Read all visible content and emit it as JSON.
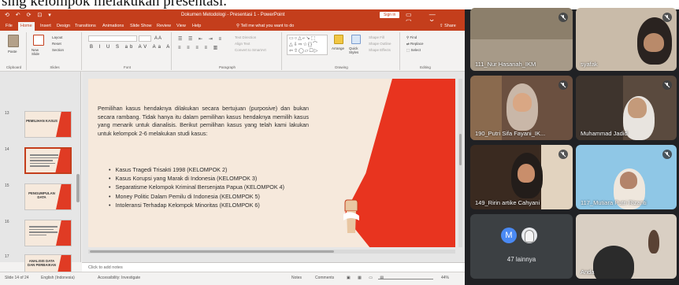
{
  "caption": {
    "text": "sing kelompok melakukan presentasi."
  },
  "powerpoint": {
    "quick_access": "⟲ ↶ ⟳ ⊡ ▾",
    "document_title": "Dokumen Metodologi - Presentasi 1 - PowerPoint",
    "sign_in": "Sign in",
    "window_controls": "▭ — ▢ ✕",
    "tabs": [
      "File",
      "Home",
      "Insert",
      "Design",
      "Transitions",
      "Animations",
      "Slide Show",
      "Review",
      "View",
      "Help"
    ],
    "tell_me": "Tell me what you want to do",
    "share": "Share",
    "ribbon_groups": [
      "Clipboard",
      "Slides",
      "Font",
      "Paragraph",
      "Drawing",
      "Editing"
    ],
    "ribbon_labels": {
      "paste": "Paste",
      "new_slide": "New Slide",
      "layout": "Layout",
      "reset": "Reset",
      "section": "Section",
      "arrange": "Arrange",
      "quick_styles": "Quick Styles",
      "shape_fill": "Shape Fill",
      "shape_outline": "Shape Outline",
      "shape_effects": "Shape Effects",
      "find": "Find",
      "replace": "Replace",
      "select": "Select",
      "text_direction": "Text Direction",
      "align_text": "Align Text",
      "convert_smartart": "Convert to SmartArt"
    },
    "thumbnails": [
      {
        "number": "13",
        "title": "PEMILIHAN KASUS",
        "active": false,
        "kind": "title"
      },
      {
        "number": "14",
        "title": "",
        "active": true,
        "kind": "lines"
      },
      {
        "number": "15",
        "title": "PENGUMPULAN DATA",
        "active": false,
        "kind": "title"
      },
      {
        "number": "16",
        "title": "",
        "active": false,
        "kind": "lines"
      },
      {
        "number": "17",
        "title": "ANALISIS DATA DAN PERBAIKAN",
        "active": false,
        "kind": "title"
      }
    ],
    "slide": {
      "paragraph": "Pemilihan kasus hendaknya dilakukan secara bertujuan (purposive) dan bukan secara rambang. Tidak hanya itu dalam pemilihan kasus hendaknya memilih kasus yang menarik untuk dianalisis. Berikut pemilihan kasus yang telah kami lakukan untuk kelompok 2-6 melakukan studi kasus:",
      "bullets": [
        "Kasus Tragedi Trisakti 1998 (KELOMPOK 2)",
        "Kasus Korupsi yang Marak di Indonesia (KELOMPOK 3)",
        "Separatisme Kelompok Kriminal Bersenjata Papua (KELOMPOK 4)",
        "Money Politic Dalam Pemilu di Indonesia (KELOMPOK 5)",
        "Intoleransi Terhadap Kelompok Minoritas (KELOMPOK 6)"
      ]
    },
    "notes_placeholder": "Click to add notes",
    "status": {
      "slide_counter": "Slide 14 of 24",
      "language": "English (Indonesia)",
      "accessibility": "Accessibility: Investigate",
      "notes": "Notes",
      "comments": "Comments",
      "zoom": "44%"
    }
  },
  "meet": {
    "participants": [
      {
        "name": "111_Nur Hasanah_IKM",
        "muted": true
      },
      {
        "name": "syafak",
        "muted": true
      },
      {
        "name": "190_Putri Sifa Fayani_IK...",
        "muted": true
      },
      {
        "name": "Muhammad Jadid",
        "muted": true
      },
      {
        "name": "149_Ririn artike Cahyani",
        "muted": true
      },
      {
        "name": "117_Mutiara Putri Rizanti",
        "muted": true
      },
      {
        "name": "Anda",
        "muted": false
      }
    ],
    "others_avatar_letter": "M",
    "others_label": "47 lainnya"
  }
}
